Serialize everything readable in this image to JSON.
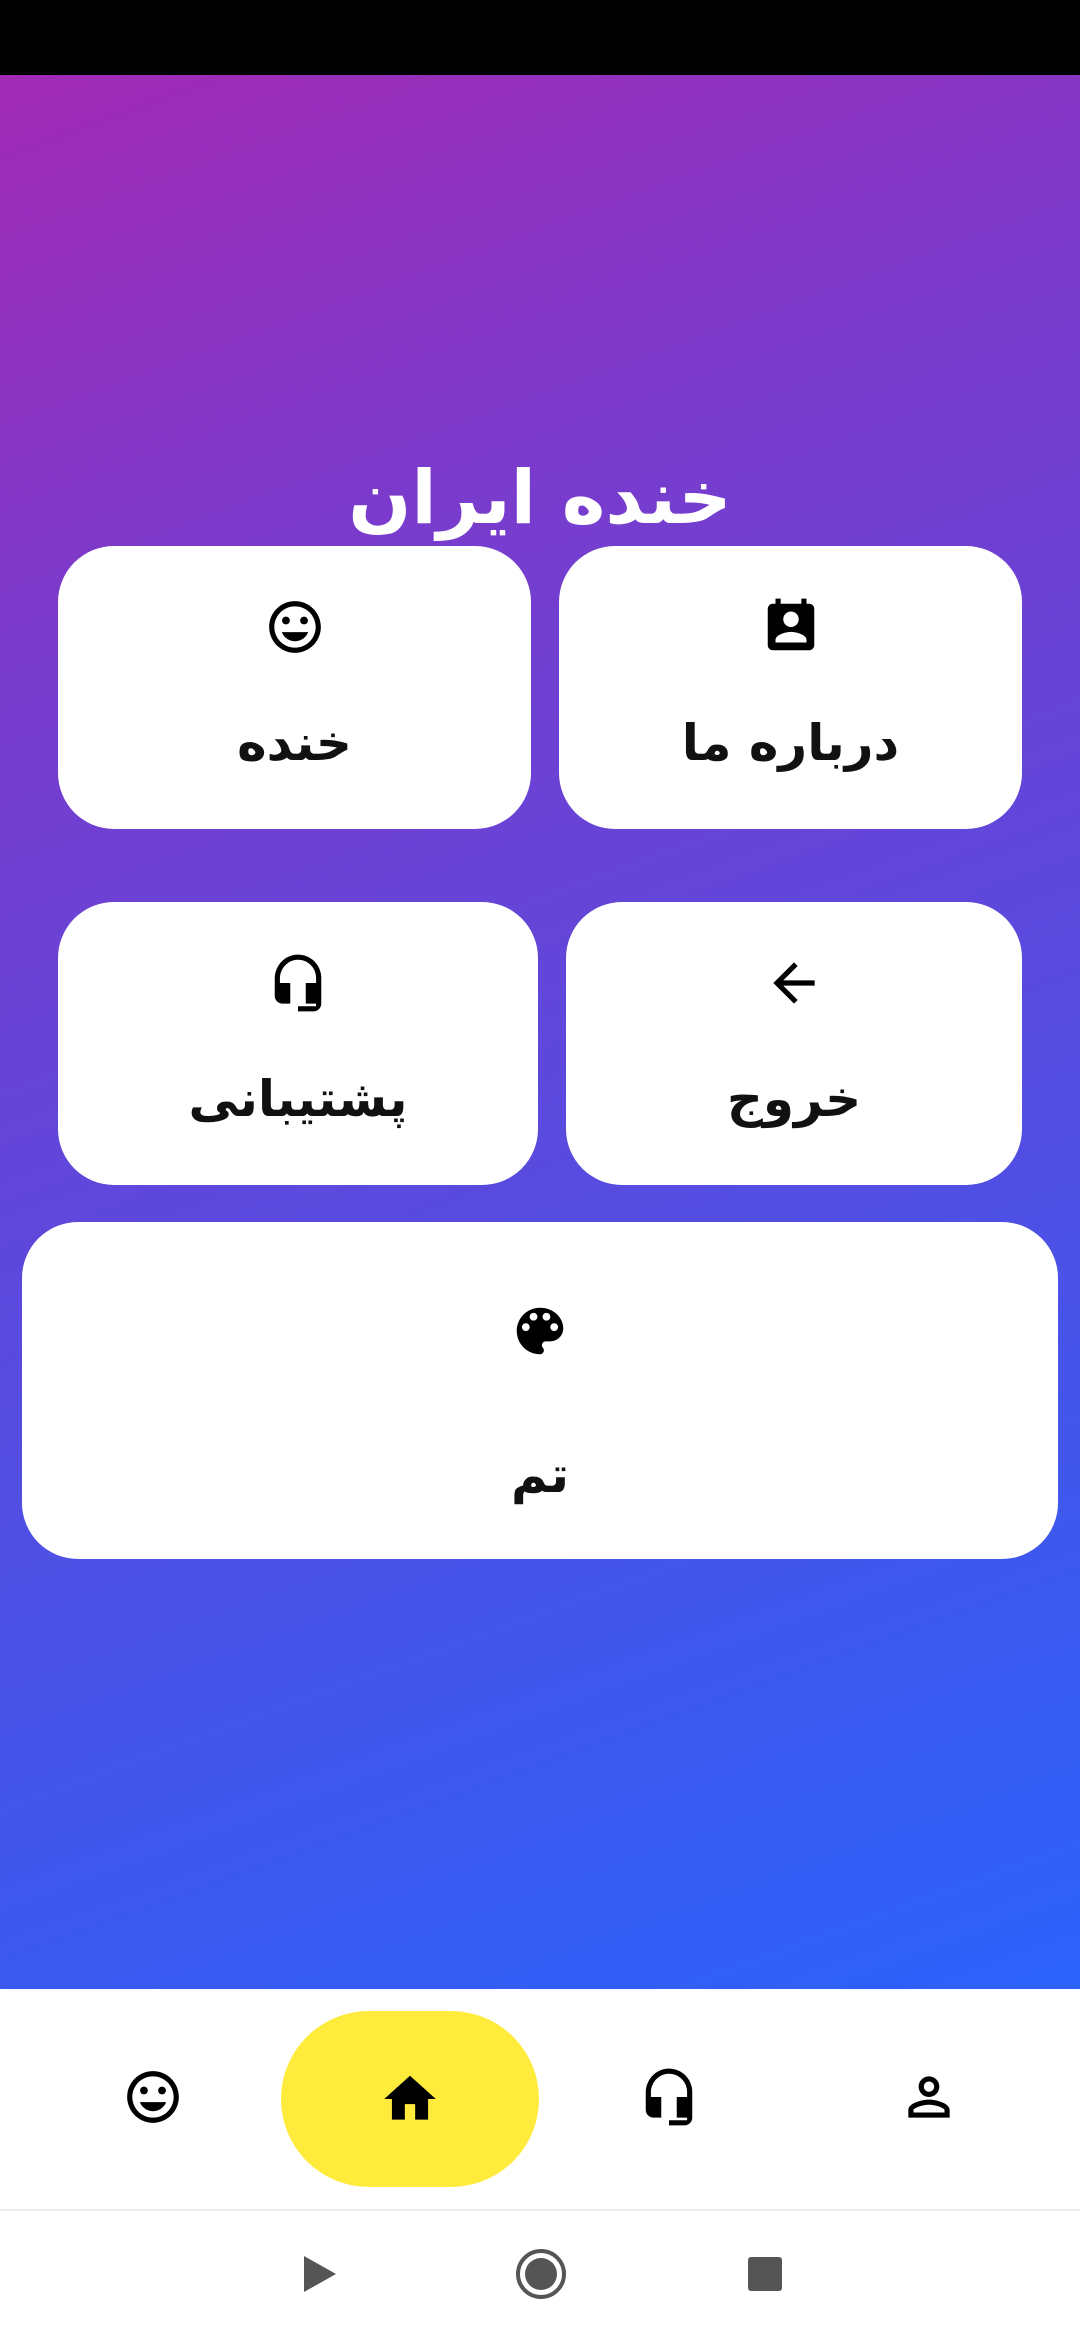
{
  "app": {
    "title": "خنده ایران"
  },
  "cards": {
    "khande": {
      "label": "خنده",
      "icon": "smiley-face-icon"
    },
    "about": {
      "label": "درباره ما",
      "icon": "contact-card-icon"
    },
    "support": {
      "label": "پشتیبانی",
      "icon": "headset-icon"
    },
    "exit": {
      "label": "خروج",
      "icon": "arrow-left-icon"
    },
    "theme": {
      "label": "تم",
      "icon": "palette-icon"
    }
  },
  "bottom_nav": {
    "items": [
      {
        "id": "laugh",
        "icon": "smiley-face-icon"
      },
      {
        "id": "home",
        "icon": "home-icon",
        "selected": true
      },
      {
        "id": "support",
        "icon": "headset-icon"
      },
      {
        "id": "profile",
        "icon": "person-icon"
      }
    ]
  },
  "system_nav": {
    "buttons": [
      "back-triangle-icon",
      "home-circle-icon",
      "recents-square-icon"
    ]
  },
  "colors": {
    "gradient_start": "#a22ab5",
    "gradient_end": "#2b62fb",
    "selected_pill": "#ffeb3b",
    "card_background": "#ffffff"
  }
}
